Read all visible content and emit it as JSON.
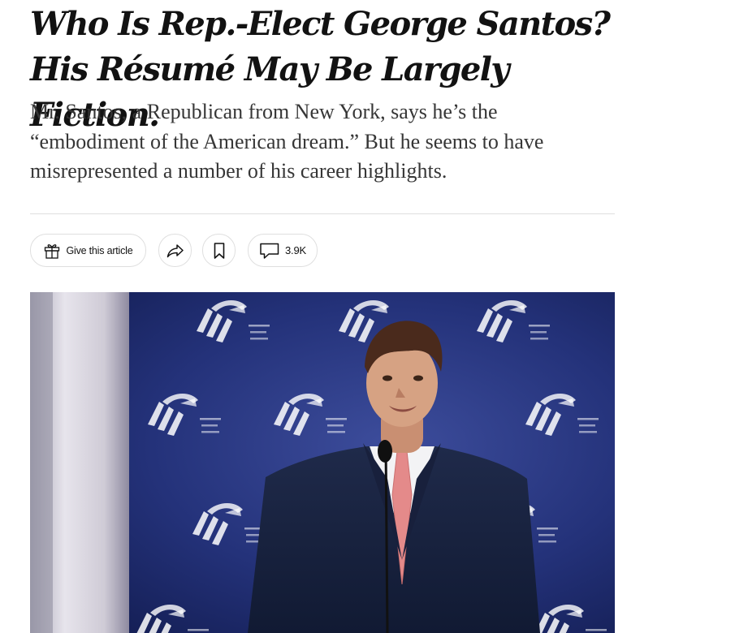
{
  "article": {
    "headline": "Who Is Rep.-Elect George Santos? His Résumé May Be Largely Fiction.",
    "summary": "Mr. Santos, a Republican from New York, says he’s the “embodiment of the American dream.” But he seems to have misrepresented a number of his career highlights."
  },
  "toolbar": {
    "gift_label": "Give this article",
    "comments_count": "3.9K"
  },
  "icons": {
    "gift": "gift-icon",
    "share": "share-arrow-icon",
    "bookmark": "bookmark-icon",
    "comment": "speech-bubble-icon"
  },
  "colors": {
    "text": "#121212",
    "summary_text": "#363636",
    "border": "#dfdfdf",
    "photo_backdrop": "#1d2b6f"
  }
}
